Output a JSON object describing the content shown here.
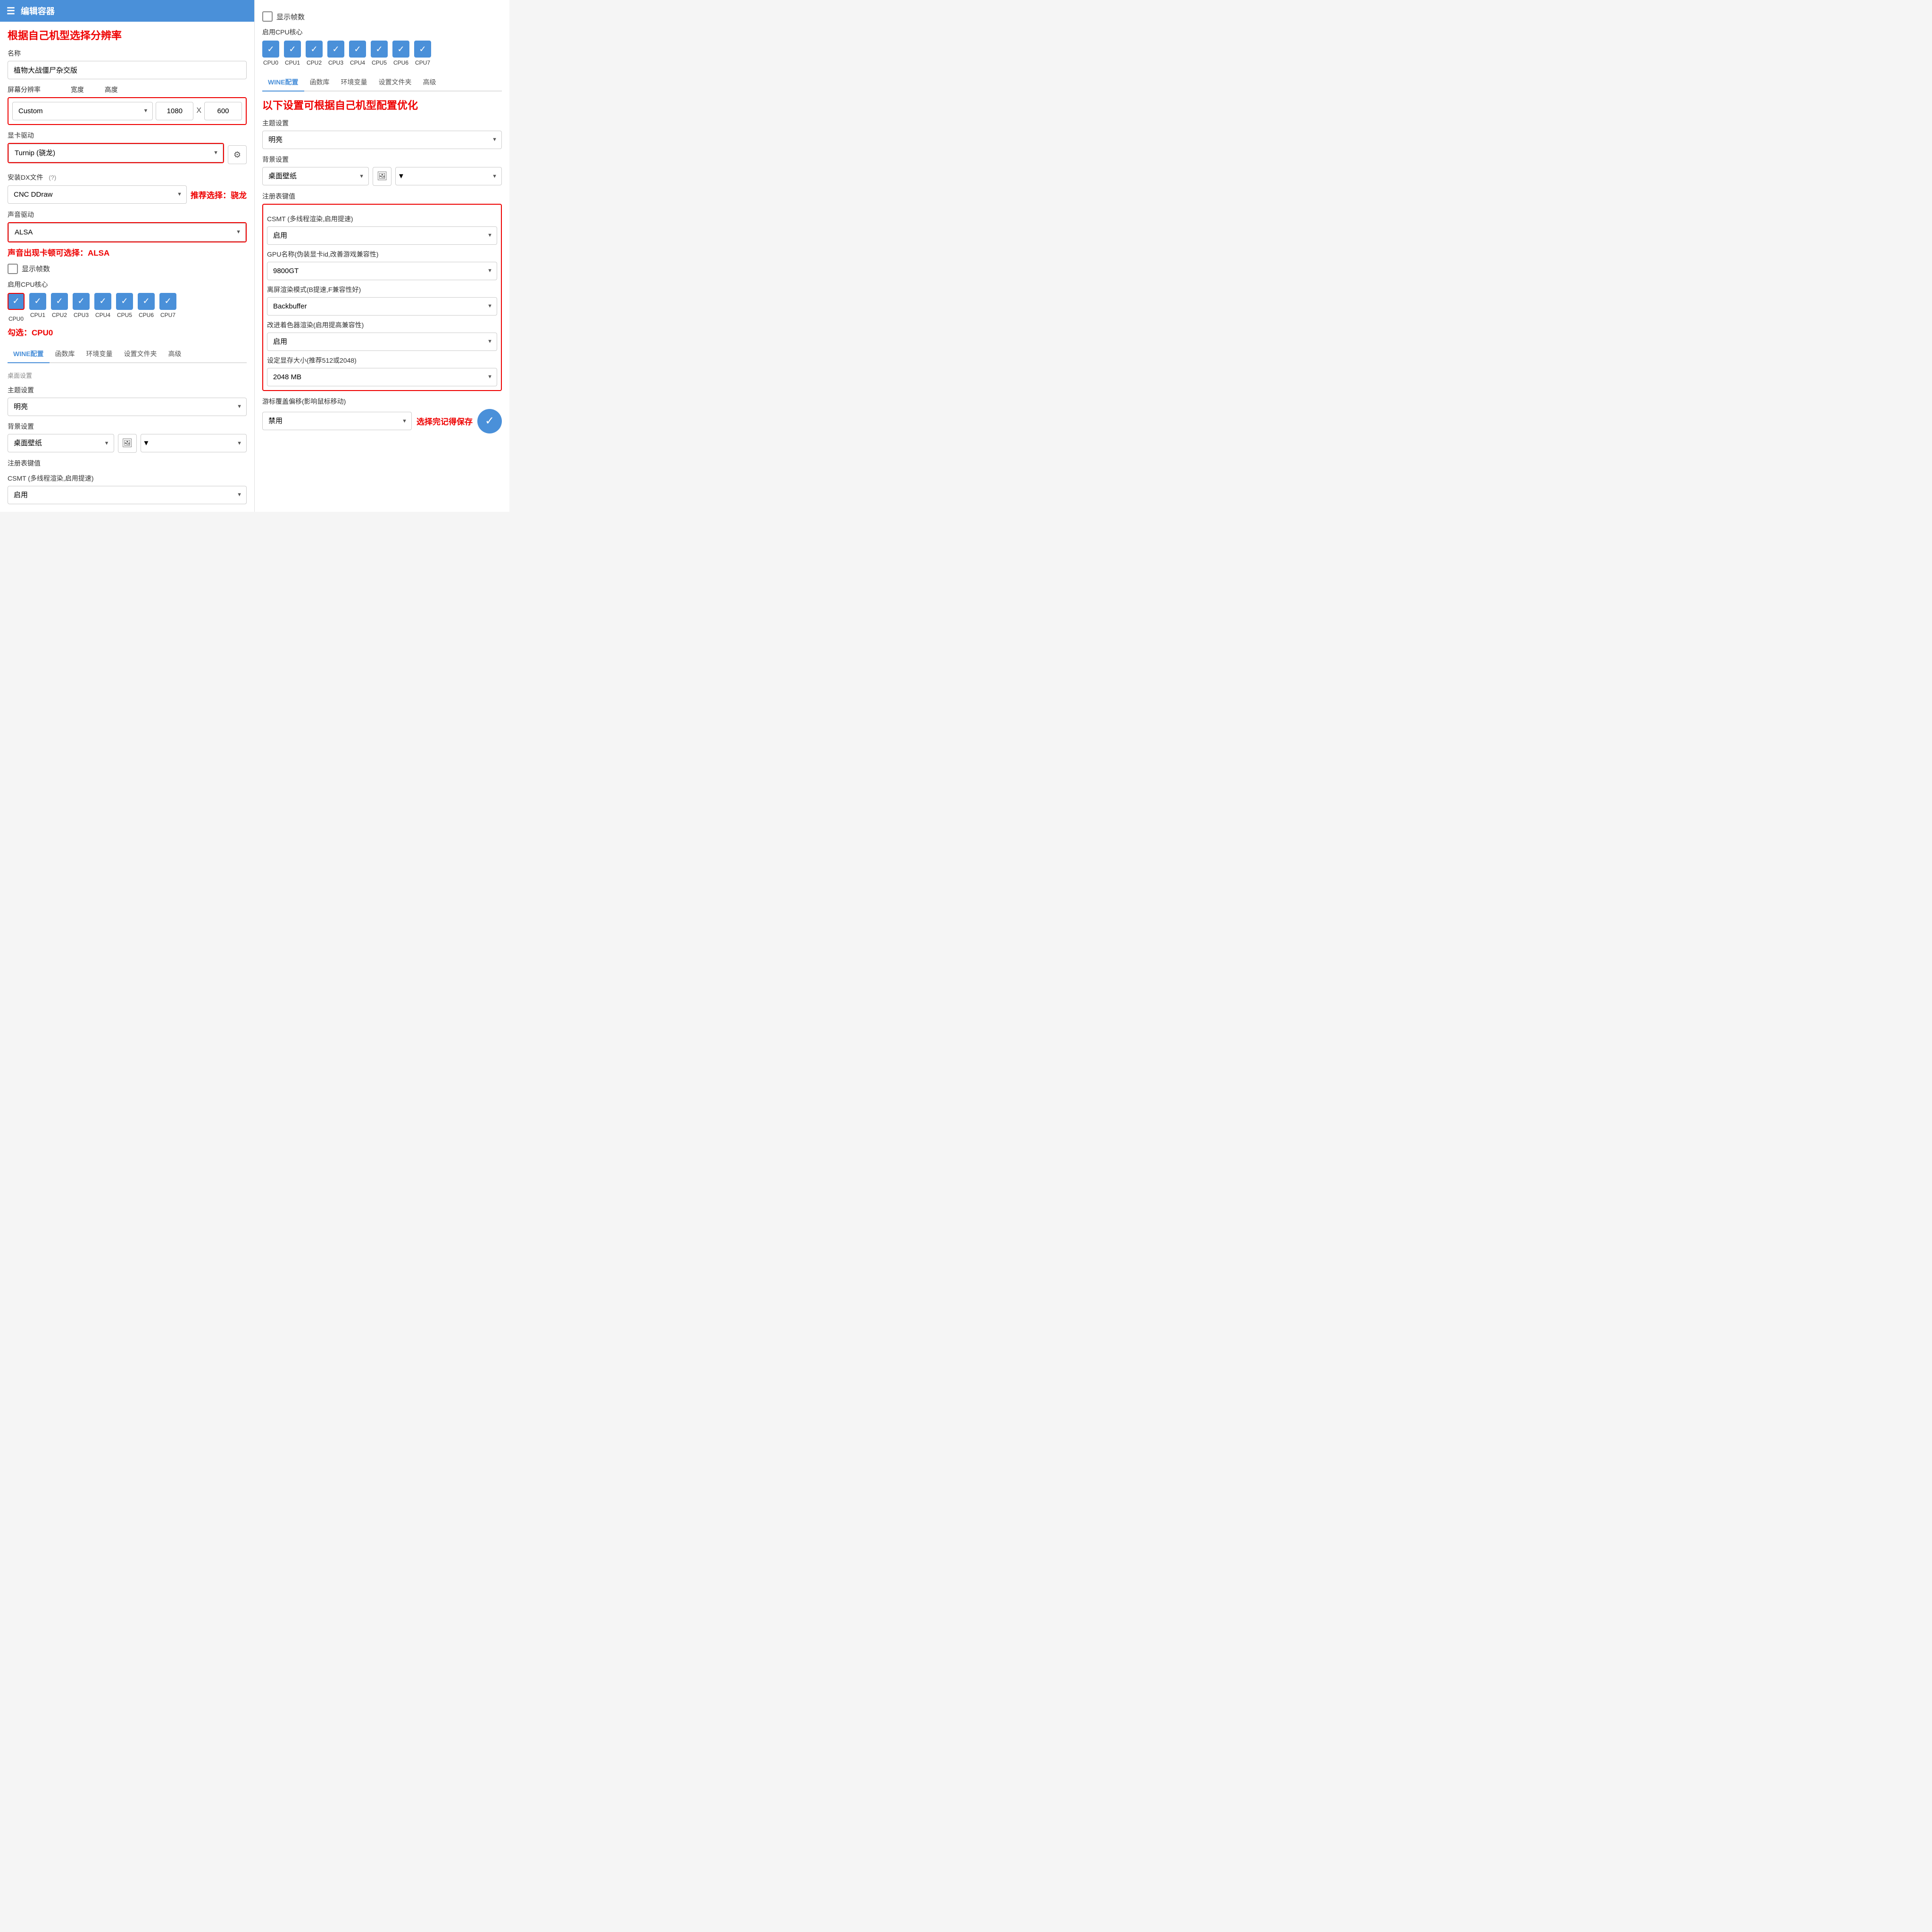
{
  "header": {
    "title": "编辑容器",
    "icon": "☰"
  },
  "left": {
    "annotation_title": "根据自己机型选择分辨率",
    "name_label": "名称",
    "name_value": "植物大战僵尸杂交版",
    "resolution_label": "屏幕分辨率",
    "width_label": "宽度",
    "height_label": "高度",
    "resolution_select": "Custom",
    "width_value": "1080",
    "height_value": "600",
    "gpu_label": "显卡驱动",
    "gpu_value": "Turnip (骁龙)",
    "dx_label": "安装DX文件",
    "dx_value": "CNC DDraw",
    "dx_annotation": "推荐选择：骁龙",
    "audio_label": "声音驱动",
    "audio_value": "ALSA",
    "audio_annotation": "声音出现卡顿可选择：ALSA",
    "show_fps_label": "显示帧数",
    "show_fps_checked": false,
    "cpu_label": "启用CPU核心",
    "cpu_annotation": "勾选：CPU0",
    "cpus": [
      {
        "label": "CPU0",
        "checked": true
      },
      {
        "label": "CPU1",
        "checked": true
      },
      {
        "label": "CPU2",
        "checked": true
      },
      {
        "label": "CPU3",
        "checked": true
      },
      {
        "label": "CPU4",
        "checked": true
      },
      {
        "label": "CPU5",
        "checked": true
      },
      {
        "label": "CPU6",
        "checked": true
      },
      {
        "label": "CPU7",
        "checked": true
      }
    ],
    "tabs": [
      "WINE配置",
      "函数库",
      "环境变量",
      "设置文件夹",
      "高级"
    ],
    "active_tab": "WINE配置",
    "desktop_section": "桌面设置",
    "theme_label": "主题设置",
    "theme_value": "明亮",
    "bg_label": "背景设置",
    "bg_value": "桌面壁纸",
    "reg_label": "注册表键值",
    "csmt_label": "CSMT (多线程渲染,启用提速)",
    "csmt_value": "启用"
  },
  "right": {
    "show_fps_label": "显示帧数",
    "show_fps_checked": false,
    "cpu_label": "启用CPU核心",
    "cpus": [
      {
        "label": "CPU0",
        "checked": true
      },
      {
        "label": "CPU1",
        "checked": true
      },
      {
        "label": "CPU2",
        "checked": true
      },
      {
        "label": "CPU3",
        "checked": true
      },
      {
        "label": "CPU4",
        "checked": true
      },
      {
        "label": "CPU5",
        "checked": true
      },
      {
        "label": "CPU6",
        "checked": true
      },
      {
        "label": "CPU7",
        "checked": true
      }
    ],
    "tabs": [
      "WINE配置",
      "函数库",
      "环境变量",
      "设置文件夹",
      "高级"
    ],
    "active_tab": "WINE配置",
    "annotation_title": "以下设置可根据自己机型配置优化",
    "theme_label": "主题设置",
    "theme_value": "明亮",
    "bg_label": "背景设置",
    "bg_value": "桌面壁纸",
    "reg_label": "注册表键值",
    "csmt_label": "CSMT (多线程渲染,启用提速)",
    "csmt_value": "启用",
    "gpu_name_label": "GPU名称(伪装显卡id,改善游戏兼容性)",
    "gpu_name_value": "9800GT",
    "offscreen_label": "离屏渲染模式(B提速,F兼容性好)",
    "offscreen_value": "Backbuffer",
    "shader_label": "改进着色器渲染(启用提高兼容性)",
    "shader_value": "启用",
    "vram_label": "设定显存大小(推荐512或2048)",
    "vram_value": "2048 MB",
    "cursor_label": "游标覆盖偏移(影响鼠标移动)",
    "cursor_value": "禁用",
    "cursor_annotation": "选择完记得保存",
    "save_icon": "✓"
  }
}
